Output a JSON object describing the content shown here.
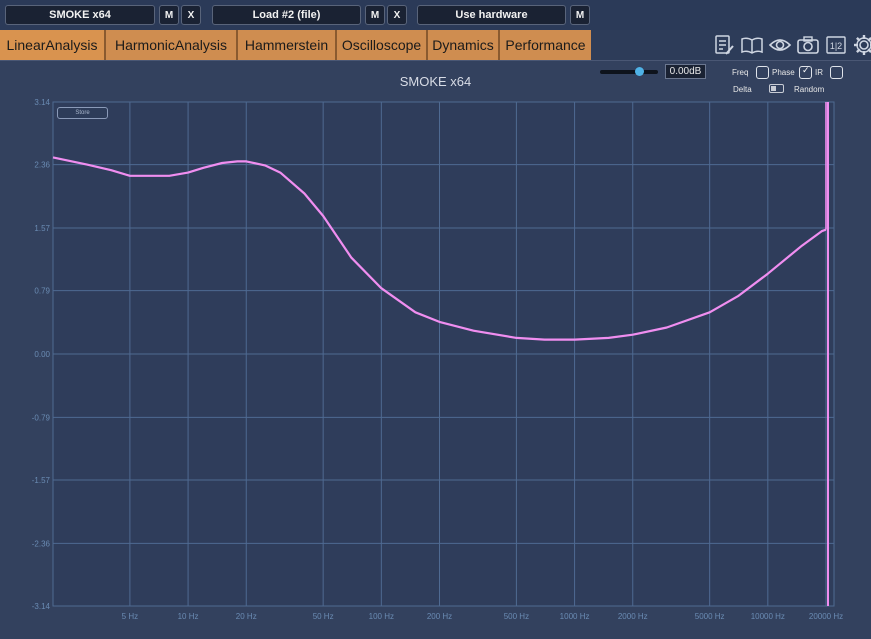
{
  "slots": [
    {
      "label": "SMOKE x64",
      "buttons": [
        "M",
        "X"
      ]
    },
    {
      "label": "Load #2 (file)",
      "buttons": [
        "M",
        "X"
      ]
    },
    {
      "label": "Use hardware",
      "buttons": [
        "M"
      ]
    }
  ],
  "tabs": [
    "LinearAnalysis",
    "HarmonicAnalysis",
    "Hammerstein",
    "Oscilloscope",
    "Dynamics",
    "Performance"
  ],
  "active_tab": "LinearAnalysis",
  "toolbar_icons": [
    "notes-icon",
    "book-icon",
    "eye-icon",
    "camera-icon",
    "split-icon",
    "gear-icon"
  ],
  "split_label": "1|2",
  "panel": {
    "title": "SMOKE x64",
    "gain_value": "0.00dB",
    "gain_level": 0.68,
    "options": {
      "freq_label": "Freq",
      "phase_label": "Phase",
      "ir_label": "IR",
      "delta_label": "Delta",
      "random_label": "Random",
      "freq_checked": false,
      "phase_checked": true,
      "ir_checked": false
    },
    "store_label": "Store"
  },
  "chart_data": {
    "type": "line",
    "xscale": "log",
    "xlim": [
      2,
      22000
    ],
    "ylim": [
      -3.14,
      3.14
    ],
    "yticks": [
      "3.14",
      "2.36",
      "1.57",
      "0.79",
      "0.00",
      "-0.79",
      "-1.57",
      "-2.36",
      "-3.14"
    ],
    "xticks": [
      "5 Hz",
      "10 Hz",
      "20 Hz",
      "50 Hz",
      "100 Hz",
      "200 Hz",
      "500 Hz",
      "1000 Hz",
      "2000 Hz",
      "5000 Hz",
      "10000 Hz",
      "20000 Hz"
    ],
    "series": [
      {
        "color": "#f08ef0",
        "x": [
          2,
          3,
          4,
          5,
          6,
          8,
          10,
          12,
          15,
          18,
          20,
          25,
          30,
          40,
          50,
          70,
          100,
          150,
          200,
          300,
          500,
          700,
          1000,
          1500,
          2000,
          3000,
          5000,
          7000,
          10000,
          15000,
          19000,
          20000
        ],
        "y": [
          2.45,
          2.36,
          2.29,
          2.22,
          2.22,
          2.22,
          2.26,
          2.32,
          2.38,
          2.4,
          2.4,
          2.35,
          2.26,
          2.0,
          1.72,
          1.2,
          0.82,
          0.52,
          0.4,
          0.29,
          0.2,
          0.18,
          0.18,
          0.2,
          0.24,
          0.33,
          0.52,
          0.72,
          1.0,
          1.35,
          1.53,
          1.55
        ]
      }
    ]
  }
}
